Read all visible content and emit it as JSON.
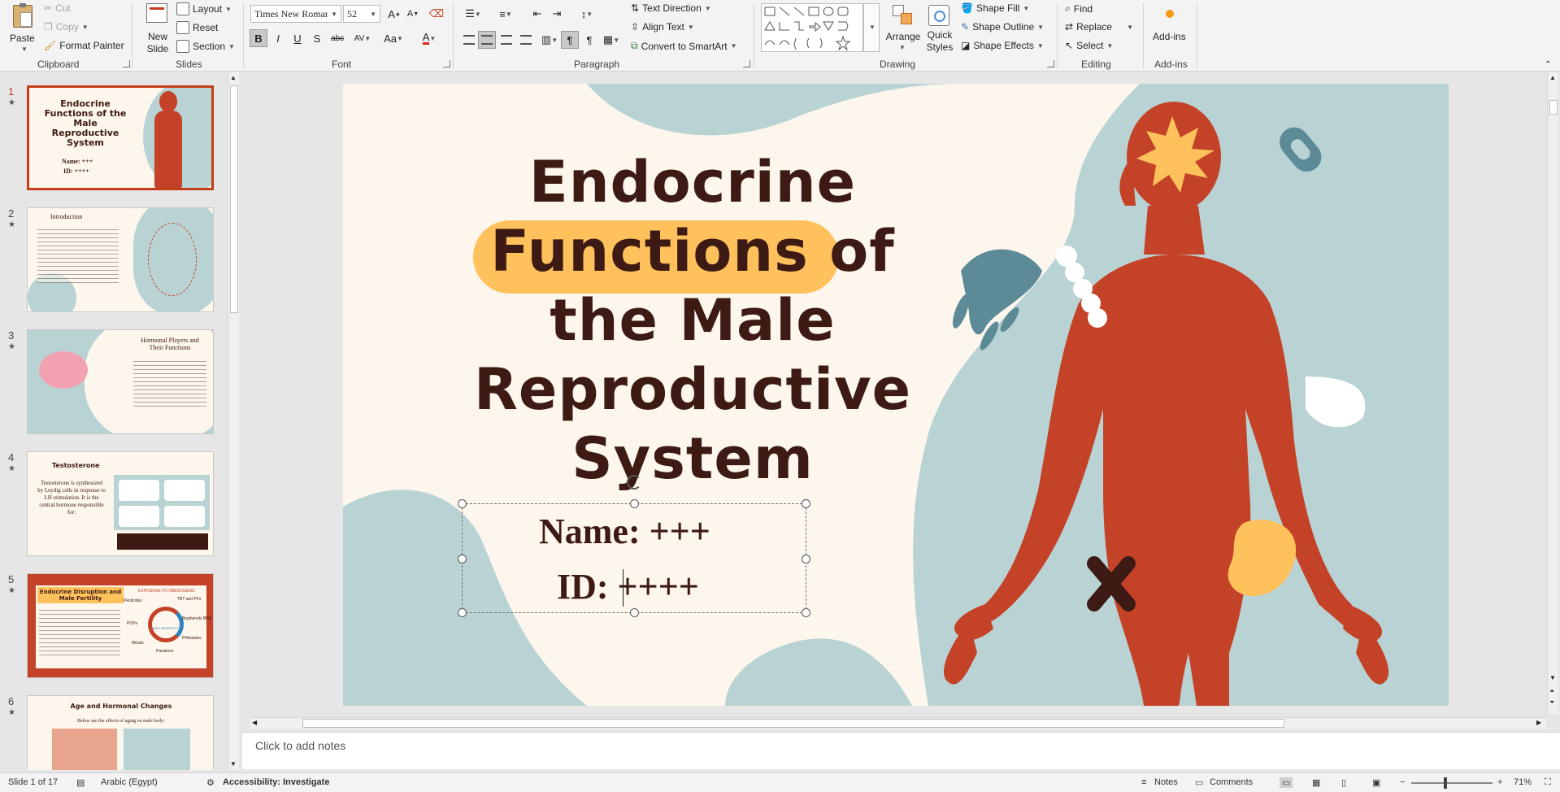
{
  "ribbon": {
    "clipboard": {
      "label": "Clipboard",
      "paste": "Paste",
      "cut": "Cut",
      "copy": "Copy",
      "format_painter": "Format Painter"
    },
    "slides": {
      "label": "Slides",
      "new_slide": "New Slide",
      "layout": "Layout",
      "reset": "Reset",
      "section": "Section"
    },
    "font": {
      "label": "Font",
      "font_name": "Times New Roman",
      "font_size": "52",
      "bold": "B",
      "italic": "I",
      "underline": "U",
      "shadow": "S",
      "strike": "abc",
      "spacing": "AV",
      "case": "Aa",
      "color": "A"
    },
    "paragraph": {
      "label": "Paragraph",
      "text_direction": "Text Direction",
      "align_text": "Align Text",
      "convert_smartart": "Convert to SmartArt"
    },
    "drawing": {
      "label": "Drawing",
      "arrange": "Arrange",
      "quick_styles": "Quick Styles",
      "shape_fill": "Shape Fill",
      "shape_outline": "Shape Outline",
      "shape_effects": "Shape Effects"
    },
    "editing": {
      "label": "Editing",
      "find": "Find",
      "replace": "Replace",
      "select": "Select"
    },
    "addins": {
      "label": "Add-ins",
      "addins": "Add-ins"
    }
  },
  "thumbnails": [
    {
      "num": "1",
      "title": "Endocrine Functions of the Male Reproductive System",
      "sub1": "Name: +++",
      "sub2": "ID: ++++"
    },
    {
      "num": "2",
      "title": "Introduction"
    },
    {
      "num": "3",
      "title": "Hormonal Players and Their Functions"
    },
    {
      "num": "4",
      "title": "Testosterone",
      "body": "Testosterone is synthesized by Leydig cells in response to LH stimulation. It is the central hormone responsible for:"
    },
    {
      "num": "5",
      "title": "Endocrine Disruption and Male Fertility",
      "center": "MALE INFERTILITY",
      "left_label": "Pesticides",
      "right_label": "TBT and PFs",
      "label3": "Bisphenols BPA",
      "label4": "Phthalates",
      "label5": "Parabens",
      "label6": "Metals",
      "label7": "POPs",
      "top_label": "EXPOSURE TO OBESOGENS"
    },
    {
      "num": "6",
      "title": "Age and Hormonal Changes",
      "sub": "Below are the effects of aging on male body:"
    }
  ],
  "slide": {
    "title_lines": [
      "Endocrine",
      "Functions of",
      "the Male",
      "Reproductive",
      "System"
    ],
    "name_line": "Name: +++",
    "id_line": "ID: ++++"
  },
  "colors": {
    "accent": "#c43e1c",
    "body_red": "#c44227",
    "teal": "#b9d3d4",
    "title_text": "#3d1a14",
    "highlight": "#ffc15c",
    "bg": "#fdf6ec"
  },
  "notes": {
    "placeholder": "Click to add notes"
  },
  "status": {
    "slide_info": "Slide 1 of 17",
    "language": "Arabic (Egypt)",
    "accessibility": "Accessibility: Investigate",
    "notes": "Notes",
    "comments": "Comments",
    "zoom": "71%"
  }
}
